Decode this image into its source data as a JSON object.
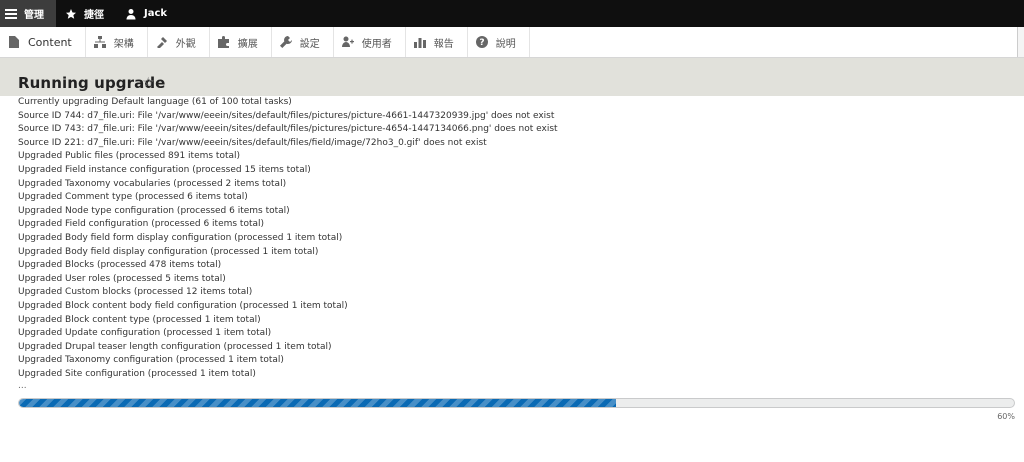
{
  "toolbar": {
    "manage_label": "管理",
    "shortcuts_label": "捷徑",
    "user_label": "Jack"
  },
  "tray": {
    "items": [
      {
        "label": "Content",
        "icon": "page-icon"
      },
      {
        "label": "架構",
        "icon": "structure-icon"
      },
      {
        "label": "外觀",
        "icon": "appearance-icon"
      },
      {
        "label": "擴展",
        "icon": "puzzle-icon"
      },
      {
        "label": "設定",
        "icon": "wrench-icon"
      },
      {
        "label": "使用者",
        "icon": "people-icon"
      },
      {
        "label": "報告",
        "icon": "bar-chart-icon"
      },
      {
        "label": "說明",
        "icon": "help-icon"
      }
    ]
  },
  "page": {
    "title": "Running upgrade",
    "favorite_icon": "star-icon"
  },
  "log": {
    "lines": [
      "Currently upgrading Default language (61 of 100 total tasks)",
      "Source ID 744: d7_file.uri: File '/var/www/eeein/sites/default/files/pictures/picture-4661-1447320939.jpg' does not exist",
      "Source ID 743: d7_file.uri: File '/var/www/eeein/sites/default/files/pictures/picture-4654-1447134066.png' does not exist",
      "Source ID 221: d7_file.uri: File '/var/www/eeein/sites/default/files/field/image/72ho3_0.gif' does not exist",
      "Upgraded Public files (processed 891 items total)",
      "Upgraded Field instance configuration (processed 15 items total)",
      "Upgraded Taxonomy vocabularies (processed 2 items total)",
      "Upgraded Comment type (processed 6 items total)",
      "Upgraded Node type configuration (processed 6 items total)",
      "Upgraded Field configuration (processed 6 items total)",
      "Upgraded Body field form display configuration (processed 1 item total)",
      "Upgraded Body field display configuration (processed 1 item total)",
      "Upgraded Blocks (processed 478 items total)",
      "Upgraded User roles (processed 5 items total)",
      "Upgraded Custom blocks (processed 12 items total)",
      "Upgraded Block content body field configuration (processed 1 item total)",
      "Upgraded Block content type (processed 1 item total)",
      "Upgraded Update configuration (processed 1 item total)",
      "Upgraded Drupal teaser length configuration (processed 1 item total)",
      "Upgraded Taxonomy configuration (processed 1 item total)",
      "Upgraded Site configuration (processed 1 item total)"
    ],
    "ellipsis": "..."
  },
  "progress": {
    "value": 0.6,
    "label": "60%"
  },
  "colors": {
    "toolbar_bg": "#0f0f0f",
    "header_bg": "#e1e1db",
    "progress_fill": "#0a6ab4"
  }
}
